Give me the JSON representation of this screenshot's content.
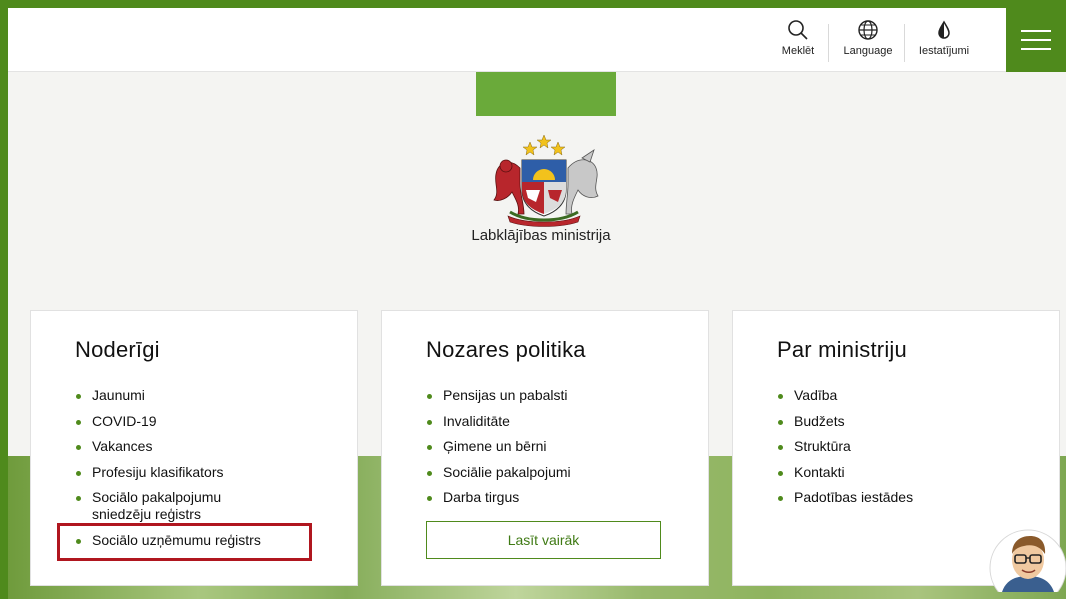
{
  "header": {
    "search_label": "Meklēt",
    "language_label": "Language",
    "settings_label": "Iestatījumi"
  },
  "ministry": {
    "name": "Labklājības ministrija"
  },
  "cards": [
    {
      "title": "Noderīgi",
      "links": [
        "Jaunumi",
        "COVID-19",
        "Vakances",
        "Profesiju klasifikators",
        "Sociālo pakalpojumu sniedzēju reģistrs",
        "Sociālo uzņēmumu reģistrs"
      ]
    },
    {
      "title": "Nozares politika",
      "links": [
        "Pensijas un pabalsti",
        "Invaliditāte",
        "Ģimene un bērni",
        "Sociālie pakalpojumi",
        "Darba tirgus"
      ],
      "button_label": "Lasīt vairāk"
    },
    {
      "title": "Par ministriju",
      "links": [
        "Vadība",
        "Budžets",
        "Struktūra",
        "Kontakti",
        "Padotības iestādes"
      ]
    }
  ],
  "icons": {
    "search": "search-icon",
    "language": "globe-icon",
    "settings": "contrast-drop-icon",
    "menu": "hamburger-menu-icon",
    "logo": "latvia-coat-of-arms",
    "assistant": "virtual-assistant-avatar"
  },
  "colors": {
    "brand_green": "#4f8a1c",
    "highlight_red": "#b0161f"
  },
  "highlighted_link": "Sociālo uzņēmumu reģistrs"
}
